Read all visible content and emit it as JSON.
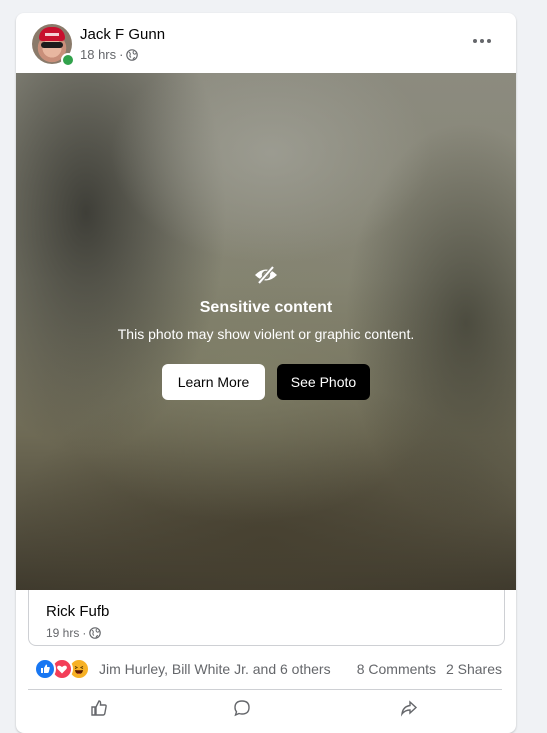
{
  "post": {
    "author": "Jack F Gunn",
    "time": "18 hrs",
    "separator": "·",
    "privacy_icon": "globe-icon",
    "more_icon": "more-options-icon"
  },
  "sensitive": {
    "icon": "eye-slash-icon",
    "title": "Sensitive content",
    "description": "This photo may show violent or graphic content.",
    "learn_more_label": "Learn More",
    "see_photo_label": "See Photo"
  },
  "shared": {
    "author": "Rick Fufb",
    "time": "19 hrs",
    "separator": "·"
  },
  "reactions": {
    "types": [
      "like",
      "love",
      "haha"
    ],
    "names": "Jim Hurley, Bill White Jr. and 6 others",
    "comments": "8 Comments",
    "shares": "2 Shares"
  },
  "colors": {
    "brand_blue": "#1877f2",
    "online_green": "#31a24c",
    "love_red": "#f33e58",
    "haha_yellow": "#f7b125"
  }
}
